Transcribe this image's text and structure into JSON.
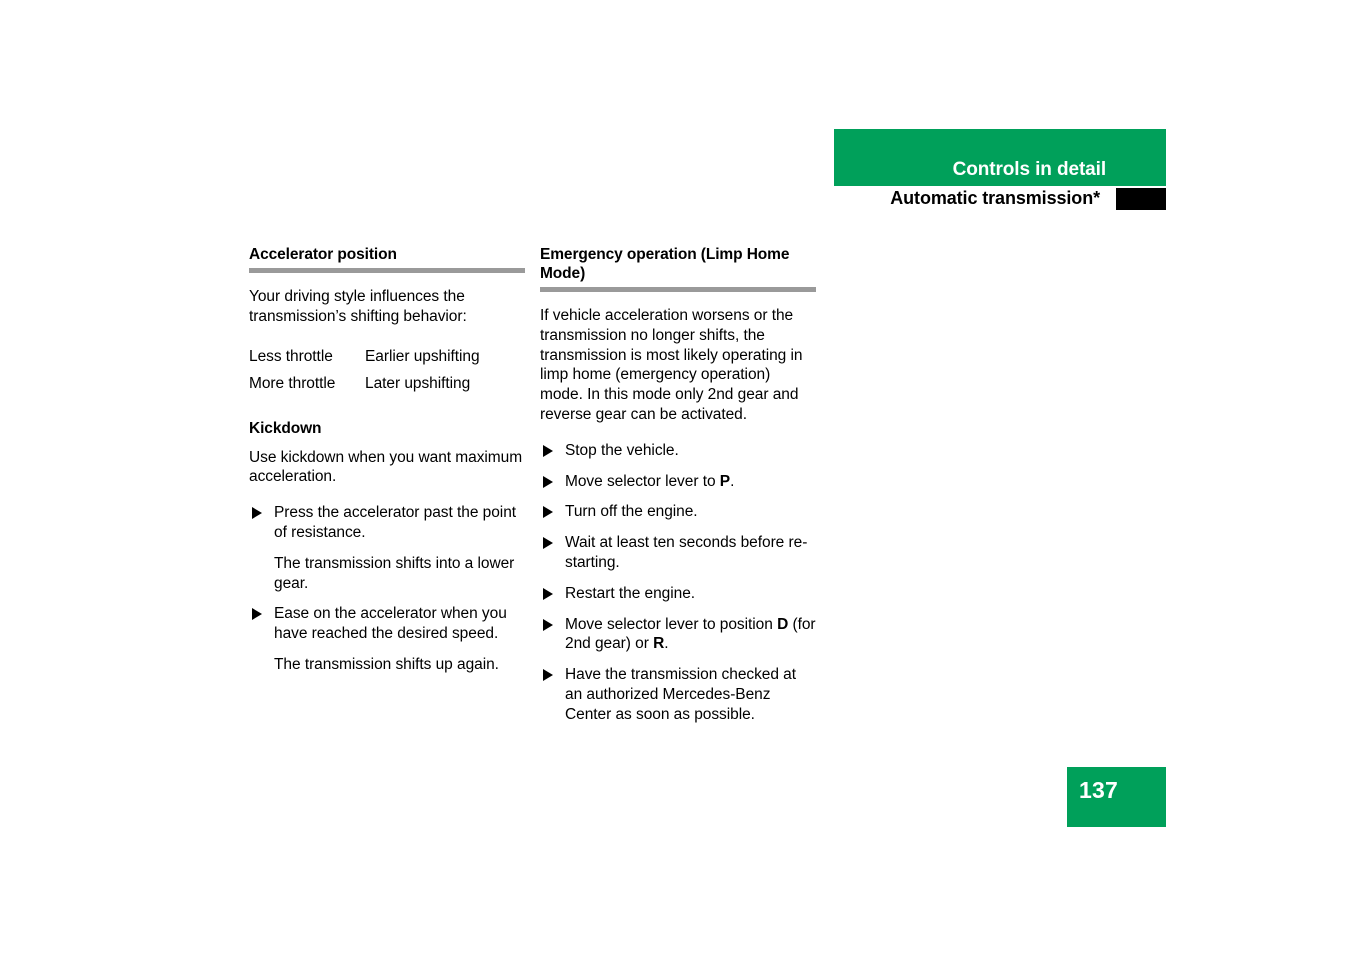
{
  "header": {
    "chapter_title": "Controls in detail",
    "section_title": "Automatic transmission*",
    "band_color": "#00A05A",
    "thumb_tab_color": "#000000",
    "thumb_tab_icon": "thumb-index-tab"
  },
  "left_column": {
    "heading": "Accelerator position",
    "intro": "Your driving style influences the transmission’s shifting behavior:",
    "throttle_table": [
      {
        "condition": "Less throttle",
        "result": "Earlier upshifting"
      },
      {
        "condition": "More throttle",
        "result": "Later upshifting"
      }
    ],
    "subheading": "Kickdown",
    "kickdown_intro": "Use kickdown when you want maximum acceleration.",
    "steps": [
      {
        "bullet": "Press the accelerator past the point of resistance.",
        "result": "The transmission shifts into a lower gear."
      },
      {
        "bullet": "Ease on the accelerator when you have reached the desired speed.",
        "result": "The transmission shifts up again."
      }
    ]
  },
  "right_column": {
    "heading": "Emergency operation (Limp Home Mode)",
    "intro": "If vehicle acceleration worsens or the transmission no longer shifts, the transmission is most likely operating in limp home (emergency operation) mode. In this mode only 2nd gear and reverse gear can be activated.",
    "steps": [
      {
        "pre": "Stop the vehicle.",
        "bold": "",
        "post": ""
      },
      {
        "pre": "Move selector lever to ",
        "bold": "P",
        "post": "."
      },
      {
        "pre": "Turn off the engine.",
        "bold": "",
        "post": ""
      },
      {
        "pre": "Wait at least ten seconds before re-starting.",
        "bold": "",
        "post": ""
      },
      {
        "pre": "Restart the engine.",
        "bold": "",
        "post": ""
      },
      {
        "pre": "Move selector lever to position ",
        "bold": "D",
        "post": " (for 2nd gear) or ",
        "bold2": "R",
        "post2": "."
      },
      {
        "pre": "Have the transmission checked at an authorized Mercedes-Benz Center as soon as possible.",
        "bold": "",
        "post": ""
      }
    ]
  },
  "footer": {
    "page_number": "137",
    "badge_color": "#00A05A"
  },
  "bullet_icon": "triangle-right-icon"
}
